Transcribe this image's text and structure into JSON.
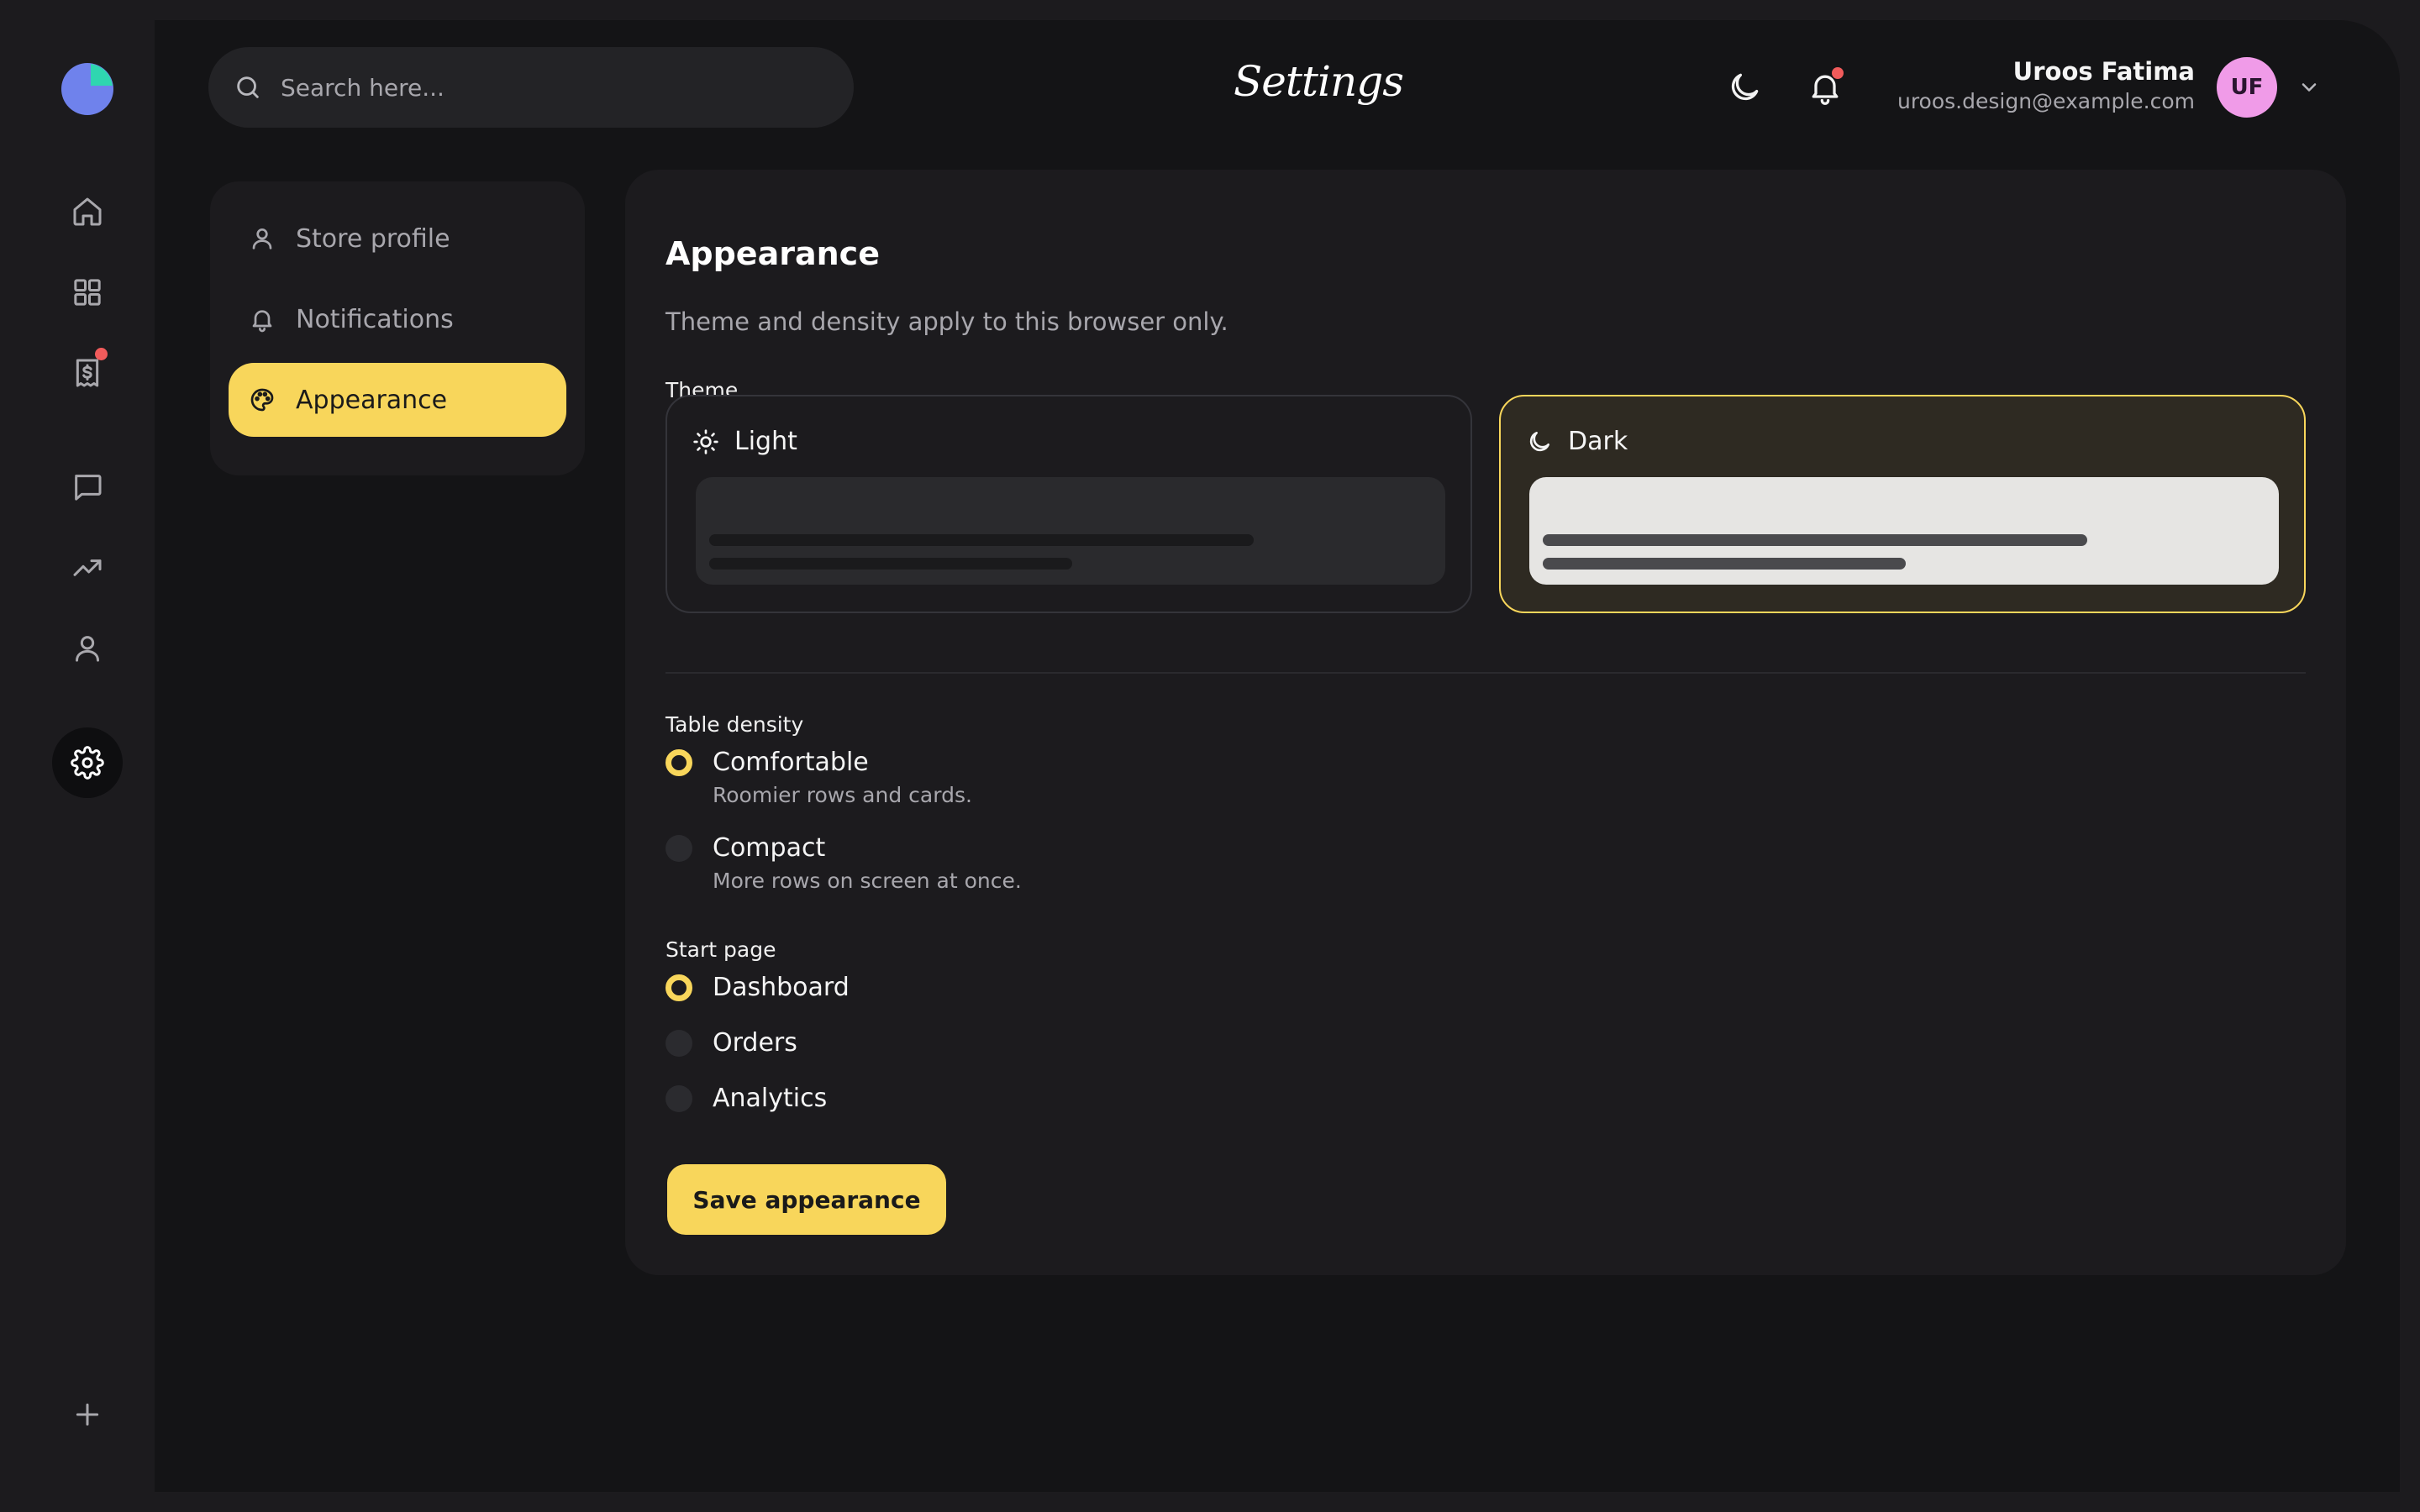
{
  "app": {
    "title": "Settings"
  },
  "colors": {
    "accent": "#f8d65b",
    "avatar": "#f09be8",
    "alert_dot": "#f15b5b",
    "logo_teal": "#2fd6b0",
    "logo_blue": "#6f82ec"
  },
  "rail": {
    "items": [
      {
        "icon": "home-icon"
      },
      {
        "icon": "grid-icon"
      },
      {
        "icon": "receipt-dollar-icon",
        "badge": true
      },
      {
        "icon": "message-icon"
      },
      {
        "icon": "trending-up-icon"
      },
      {
        "icon": "user-icon"
      },
      {
        "icon": "gear-icon",
        "active": true
      },
      {
        "icon": "plus-icon"
      }
    ]
  },
  "search": {
    "placeholder": "Search here..."
  },
  "header": {
    "title": "Settings"
  },
  "user": {
    "name": "Uroos Fatima",
    "email": "uroos.design@example.com",
    "initials": "UF"
  },
  "sidebar": {
    "items": [
      {
        "label": "Store profile",
        "icon": "user-icon"
      },
      {
        "label": "Notifications",
        "icon": "bell-icon"
      },
      {
        "label": "Appearance",
        "icon": "palette-icon",
        "active": true
      }
    ]
  },
  "appearance": {
    "title": "Appearance",
    "description": "Theme and density apply to this browser only.",
    "theme_label": "Theme",
    "themes": [
      {
        "label": "Light",
        "icon": "sun-icon",
        "selected": false
      },
      {
        "label": "Dark",
        "icon": "moon-icon",
        "selected": true
      }
    ],
    "density_label": "Table density",
    "density_options": [
      {
        "label": "Comfortable",
        "description": "Roomier rows and cards.",
        "selected": true
      },
      {
        "label": "Compact",
        "description": "More rows on screen at once.",
        "selected": false
      }
    ],
    "start_page_label": "Start page",
    "start_page_options": [
      {
        "label": "Dashboard",
        "selected": true
      },
      {
        "label": "Orders",
        "selected": false
      },
      {
        "label": "Analytics",
        "selected": false
      }
    ],
    "save_label": "Save appearance"
  }
}
